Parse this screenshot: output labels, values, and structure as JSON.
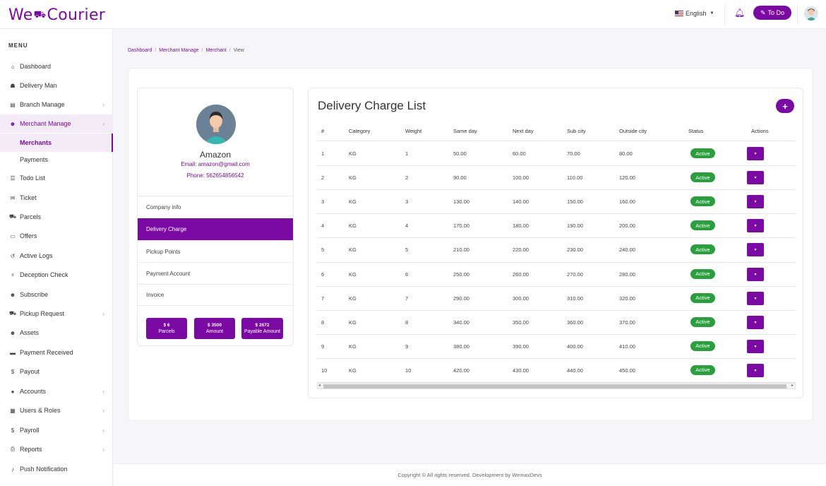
{
  "header": {
    "logo_left": "We",
    "logo_mid": "⛟",
    "logo_right": "Courier",
    "language": "English",
    "todo_label": "To Do"
  },
  "sidebar": {
    "menu_title": "MENU",
    "items": [
      {
        "label": "Dashboard",
        "icon": "home-icon",
        "glyph": "⌂"
      },
      {
        "label": "Delivery Man",
        "icon": "delivery-man-icon",
        "glyph": "☗"
      },
      {
        "label": "Branch Manage",
        "icon": "building-icon",
        "glyph": "▤"
      },
      {
        "label": "Merchant Manage",
        "icon": "users-icon",
        "glyph": "☻"
      },
      {
        "label": "Merchants"
      },
      {
        "label": "Payments"
      },
      {
        "label": "Todo List",
        "icon": "list-icon",
        "glyph": "☰"
      },
      {
        "label": "Ticket",
        "icon": "comments-icon",
        "glyph": "✉"
      },
      {
        "label": "Parcels",
        "icon": "dolly-icon",
        "glyph": "⛟"
      },
      {
        "label": "Offers",
        "icon": "offer-icon",
        "glyph": "▭"
      },
      {
        "label": "Active Logs",
        "icon": "history-icon",
        "glyph": "↺"
      },
      {
        "label": "Deception Check",
        "icon": "user-x-icon",
        "glyph": "☓"
      },
      {
        "label": "Subscribe",
        "icon": "users-icon",
        "glyph": "☻"
      },
      {
        "label": "Pickup Request",
        "icon": "truck-icon",
        "glyph": "⛟"
      },
      {
        "label": "Assets",
        "icon": "users-icon",
        "glyph": "☻"
      },
      {
        "label": "Payment Received",
        "icon": "card-icon",
        "glyph": "▬"
      },
      {
        "label": "Payout",
        "icon": "hand-money-icon",
        "glyph": "$"
      },
      {
        "label": "Accounts",
        "icon": "user-icon",
        "glyph": "●"
      },
      {
        "label": "Users & Roles",
        "icon": "grid-icon",
        "glyph": "▦"
      },
      {
        "label": "Payroll",
        "icon": "hand-money-icon",
        "glyph": "$"
      },
      {
        "label": "Reports",
        "icon": "print-icon",
        "glyph": "⎙"
      },
      {
        "label": "Push Notification",
        "icon": "bell-icon",
        "glyph": "♪"
      }
    ]
  },
  "breadcrumb": [
    "Dashboard",
    "Merchant Manage",
    "Merchant",
    "View"
  ],
  "profile": {
    "name": "Amazon",
    "email": "Email: amazon@gmail.com",
    "phone": "Phone: 562654856542",
    "tabs": [
      "Company info",
      "Delivery Charge",
      "Pickup Points",
      "Payment Account",
      "Invoice"
    ],
    "stats": [
      {
        "value": "$ 6",
        "label": "Parcels"
      },
      {
        "value": "$ 3500",
        "label": "Amount"
      },
      {
        "value": "$ 2672",
        "label": "Payable Amount"
      }
    ]
  },
  "list": {
    "title": "Delivery Charge List",
    "add_label": "+",
    "columns": [
      "#",
      "Category",
      "Weight",
      "Same day",
      "Next day",
      "Sub city",
      "Outside city",
      "Status",
      "Actions"
    ],
    "action_glyph": "▾",
    "rows": [
      [
        "1",
        "KG",
        "1",
        "50.00",
        "60.00",
        "70.00",
        "80.00",
        "Active"
      ],
      [
        "2",
        "KG",
        "2",
        "90.00",
        "100.00",
        "110.00",
        "120.00",
        "Active"
      ],
      [
        "3",
        "KG",
        "3",
        "130.00",
        "140.00",
        "150.00",
        "160.00",
        "Active"
      ],
      [
        "4",
        "KG",
        "4",
        "170.00",
        "180.00",
        "190.00",
        "200.00",
        "Active"
      ],
      [
        "5",
        "KG",
        "5",
        "210.00",
        "220.00",
        "230.00",
        "240.00",
        "Active"
      ],
      [
        "6",
        "KG",
        "6",
        "250.00",
        "260.00",
        "270.00",
        "280.00",
        "Active"
      ],
      [
        "7",
        "KG",
        "7",
        "290.00",
        "300.00",
        "310.00",
        "320.00",
        "Active"
      ],
      [
        "8",
        "KG",
        "8",
        "340.00",
        "350.00",
        "360.00",
        "370.00",
        "Active"
      ],
      [
        "9",
        "KG",
        "9",
        "380.00",
        "390.00",
        "400.00",
        "410.00",
        "Active"
      ],
      [
        "10",
        "KG",
        "10",
        "420.00",
        "430.00",
        "440.00",
        "450.00",
        "Active"
      ]
    ]
  },
  "footer": "Copyright © All rights reserved. Development by WemaxDevs",
  "colors": {
    "brand": "#7a0aa3",
    "active_badge": "#29a03d"
  }
}
